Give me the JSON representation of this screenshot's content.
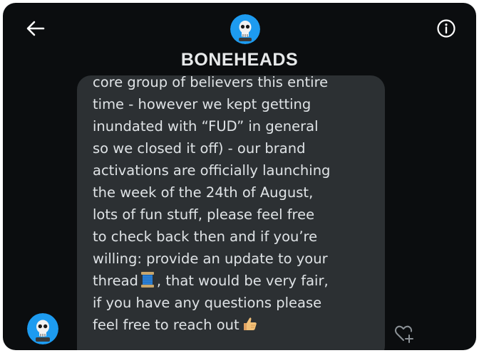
{
  "header": {
    "title": "BONEHEADS",
    "back_icon": "arrow-left-icon",
    "info_icon": "info-circle-icon",
    "avatar": "skull-avatar"
  },
  "message": {
    "lines": [
      "core group of believers this entire",
      "time - however we kept getting",
      "inundated with “FUD” in general",
      "so we closed it off) - our brand",
      "activations are officially launching",
      "the week of the 24th of August,",
      "lots of fun stuff, please feel free",
      "to check back then and if you’re",
      "willing: provide an update to your"
    ],
    "line_thread_before": "thread",
    "line_thread_after": ", that would be very fair,",
    "line_questions": "if you have any questions please",
    "line_last": "feel free to reach out",
    "emoji_thread": "spool-of-thread-emoji",
    "emoji_thumbs": "thumbs-up-emoji",
    "reaction_icon": "heart-add-icon"
  },
  "colors": {
    "background": "#0b0d0f",
    "bubble": "#2c3033",
    "text": "#dfe3e6",
    "avatar_blue": "#1d9bf0"
  }
}
